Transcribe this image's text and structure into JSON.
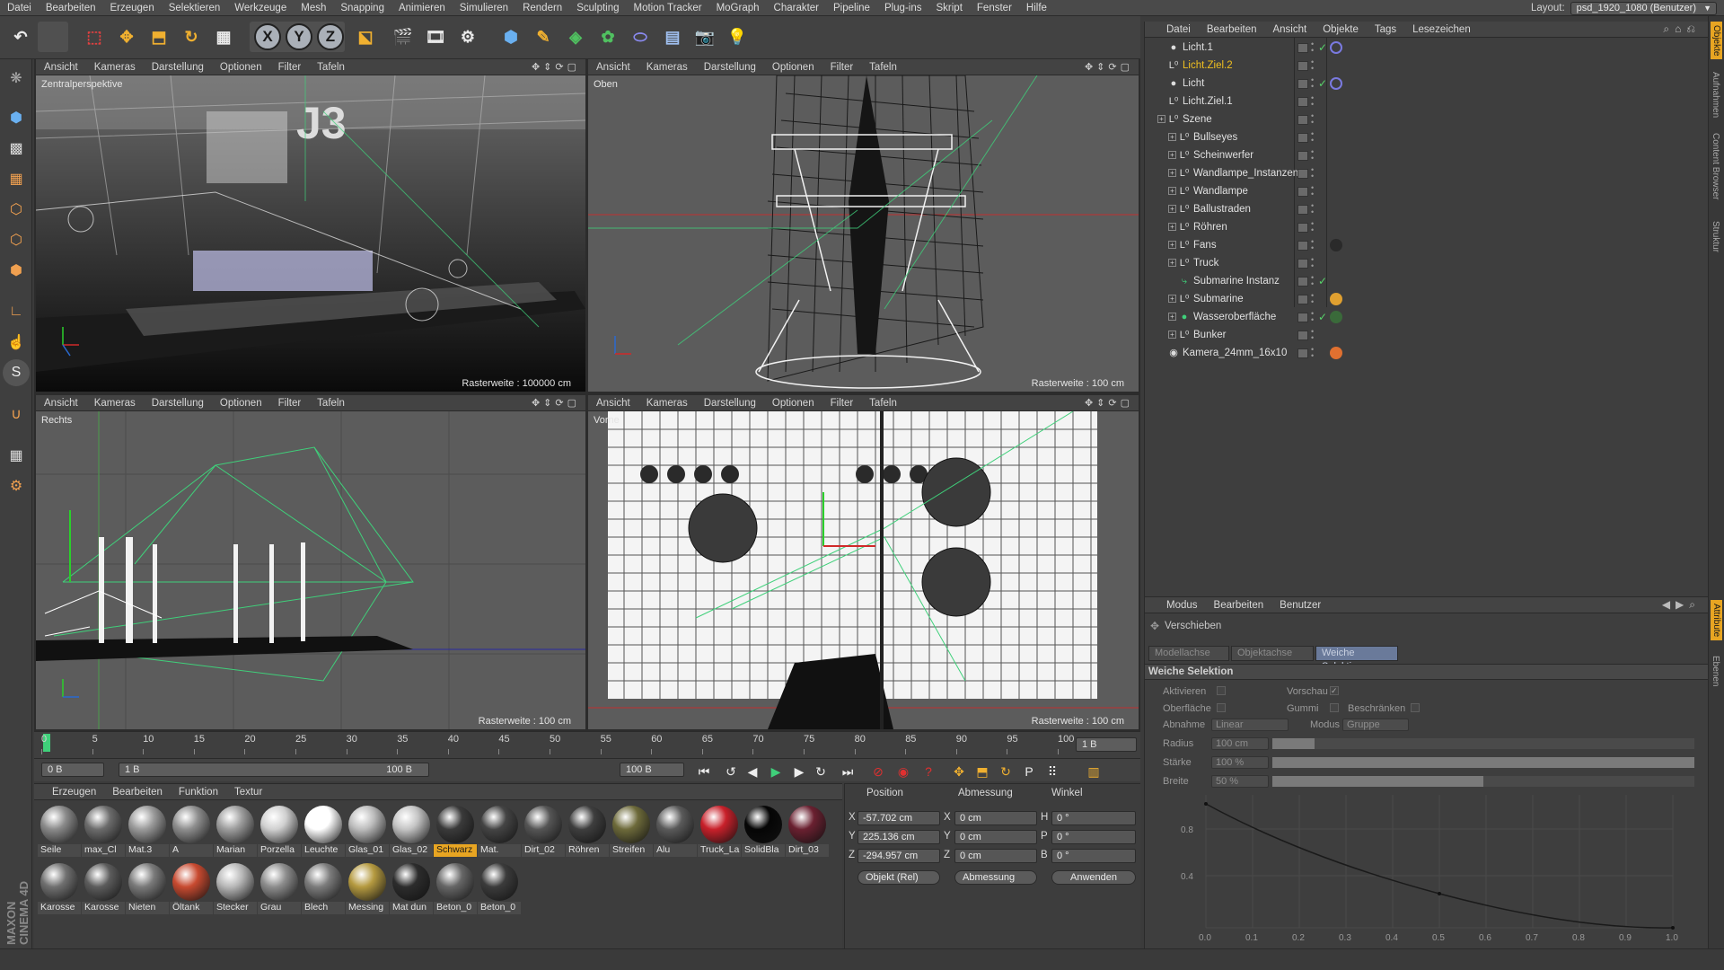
{
  "menubar": {
    "items": [
      "Datei",
      "Bearbeiten",
      "Erzeugen",
      "Selektieren",
      "Werkzeuge",
      "Mesh",
      "Snapping",
      "Animieren",
      "Simulieren",
      "Rendern",
      "Sculpting",
      "Motion Tracker",
      "MoGraph",
      "Charakter",
      "Pipeline",
      "Plug-ins",
      "Skript",
      "Fenster",
      "Hilfe"
    ],
    "layout_label": "Layout:",
    "layout_value": "psd_1920_1080 (Benutzer)"
  },
  "toolbar": {
    "axes": [
      "X",
      "Y",
      "Z"
    ]
  },
  "viewport_menu": [
    "Ansicht",
    "Kameras",
    "Darstellung",
    "Optionen",
    "Filter",
    "Tafeln"
  ],
  "viewports": [
    {
      "name": "Zentralperspektive",
      "grid": "Rasterweite : 100000 cm"
    },
    {
      "name": "Oben",
      "grid": "Rasterweite : 100 cm"
    },
    {
      "name": "Rechts",
      "grid": "Rasterweite : 100 cm"
    },
    {
      "name": "Vorne",
      "grid": "Rasterweite : 100 cm"
    }
  ],
  "timeline": {
    "ticks": [
      "0",
      "5",
      "10",
      "15",
      "20",
      "25",
      "30",
      "35",
      "40",
      "45",
      "50",
      "55",
      "60",
      "65",
      "70",
      "75",
      "80",
      "85",
      "90",
      "95",
      "100"
    ],
    "current_frame": "1 B",
    "start": "0 B",
    "range_start": "1 B",
    "range_end": "100 B",
    "end": "100 B"
  },
  "material_manager": {
    "menu": [
      "Erzeugen",
      "Bearbeiten",
      "Funktion",
      "Textur"
    ],
    "materials": [
      {
        "label": "Seile",
        "color": "#8a8a8a"
      },
      {
        "label": "max_Cl",
        "color": "#6c6c6c"
      },
      {
        "label": "Mat.3",
        "color": "#9a9a9a"
      },
      {
        "label": "A",
        "color": "#8e8e8e"
      },
      {
        "label": "Marian",
        "color": "#9d9d9d"
      },
      {
        "label": "Porzella",
        "color": "#d0d0d0"
      },
      {
        "label": "Leuchte",
        "color": "#ffffff"
      },
      {
        "label": "Glas_01",
        "color": "#bcbcbc"
      },
      {
        "label": "Glas_02",
        "color": "#c4c4c4"
      },
      {
        "label": "Schwarz",
        "color": "#3a3a3a"
      },
      {
        "label": "Mat.",
        "color": "#444444"
      },
      {
        "label": "Dirt_02",
        "color": "#555555"
      },
      {
        "label": "Röhren",
        "color": "#3e3e3e"
      },
      {
        "label": "Streifen",
        "color": "#6d6a3a"
      },
      {
        "label": "Alu",
        "color": "#5a5a5a"
      },
      {
        "label": "Truck_La",
        "color": "#c8202a"
      },
      {
        "label": "SolidBla",
        "color": "#050505"
      },
      {
        "label": "Dirt_03",
        "color": "#6a2030"
      },
      {
        "label": "Karosse",
        "color": "#707070"
      },
      {
        "label": "Karosse",
        "color": "#5c5c5c"
      },
      {
        "label": "Nieten",
        "color": "#7a7a7a"
      },
      {
        "label": "Öltank",
        "color": "#c84a30"
      },
      {
        "label": "Stecker",
        "color": "#b8b8b8"
      },
      {
        "label": "Grau",
        "color": "#8d8d8d"
      },
      {
        "label": "Blech",
        "color": "#7c7c7c"
      },
      {
        "label": "Messing",
        "color": "#b59a40"
      },
      {
        "label": "Mat dun",
        "color": "#2c2c2c"
      },
      {
        "label": "Beton_0",
        "color": "#666666"
      },
      {
        "label": "Beton_0",
        "color": "#3b3b3b"
      }
    ],
    "selected_index": 9
  },
  "coord_manager": {
    "headers": [
      "Position",
      "Abmessung",
      "Winkel"
    ],
    "rows": [
      {
        "axis": "X",
        "pos": "-57.702 cm",
        "size_axis": "X",
        "size": "0 cm",
        "rot_axis": "H",
        "rot": "0 °"
      },
      {
        "axis": "Y",
        "pos": "225.136 cm",
        "size_axis": "Y",
        "size": "0 cm",
        "rot_axis": "P",
        "rot": "0 °"
      },
      {
        "axis": "Z",
        "pos": "-294.957 cm",
        "size_axis": "Z",
        "size": "0 cm",
        "rot_axis": "B",
        "rot": "0 °"
      }
    ],
    "mode": "Objekt (Rel)",
    "size_mode": "Abmessung",
    "apply": "Anwenden"
  },
  "object_manager": {
    "menu": [
      "Datei",
      "Bearbeiten",
      "Ansicht",
      "Objekte",
      "Tags",
      "Lesezeichen"
    ],
    "objects": [
      {
        "name": "Licht.1",
        "indent": 0,
        "expand": false,
        "icon": "light-icon",
        "check": true,
        "tag": "target-tag"
      },
      {
        "name": "Licht.Ziel.2",
        "indent": 0,
        "expand": false,
        "icon": "null-icon",
        "check": false,
        "tag": "",
        "highlight": true
      },
      {
        "name": "Licht",
        "indent": 0,
        "expand": false,
        "icon": "light-icon",
        "check": true,
        "tag": "target-tag"
      },
      {
        "name": "Licht.Ziel.1",
        "indent": 0,
        "expand": false,
        "icon": "null-icon",
        "check": false,
        "tag": ""
      },
      {
        "name": "Szene",
        "indent": 0,
        "expand": true,
        "icon": "null-icon",
        "check": false,
        "tag": ""
      },
      {
        "name": "Bullseyes",
        "indent": 1,
        "expand": true,
        "icon": "null-icon",
        "check": false,
        "tag": ""
      },
      {
        "name": "Scheinwerfer",
        "indent": 1,
        "expand": true,
        "icon": "null-icon",
        "check": false,
        "tag": ""
      },
      {
        "name": "Wandlampe_Instanzen",
        "indent": 1,
        "expand": true,
        "icon": "null-icon",
        "check": false,
        "tag": ""
      },
      {
        "name": "Wandlampe",
        "indent": 1,
        "expand": true,
        "icon": "null-icon",
        "check": false,
        "tag": ""
      },
      {
        "name": "Ballustraden",
        "indent": 1,
        "expand": true,
        "icon": "null-icon",
        "check": false,
        "tag": ""
      },
      {
        "name": "Röhren",
        "indent": 1,
        "expand": true,
        "icon": "null-icon",
        "check": false,
        "tag": ""
      },
      {
        "name": "Fans",
        "indent": 1,
        "expand": true,
        "icon": "null-icon",
        "check": false,
        "tag": "material-tag"
      },
      {
        "name": "Truck",
        "indent": 1,
        "expand": true,
        "icon": "null-icon",
        "check": false,
        "tag": ""
      },
      {
        "name": "Submarine Instanz",
        "indent": 1,
        "expand": false,
        "icon": "instance-icon",
        "check": true,
        "tag": ""
      },
      {
        "name": "Submarine",
        "indent": 1,
        "expand": true,
        "icon": "null-icon",
        "check": false,
        "tag": "lock-tag"
      },
      {
        "name": "Wasseroberfläche",
        "indent": 1,
        "expand": true,
        "icon": "plane-icon",
        "check": true,
        "tag": "water-tag"
      },
      {
        "name": "Bunker",
        "indent": 1,
        "expand": true,
        "icon": "null-icon",
        "check": false,
        "tag": ""
      },
      {
        "name": "Kamera_24mm_16x10",
        "indent": 0,
        "expand": false,
        "icon": "camera-icon",
        "check": false,
        "tag": "stop-tag"
      }
    ]
  },
  "attribute_manager": {
    "menu": [
      "Modus",
      "Bearbeiten",
      "Benutzer"
    ],
    "tool_name": "Verschieben",
    "tabs": [
      "Modellachse",
      "Objektachse",
      "Weiche Selektion"
    ],
    "active_tab": 2,
    "section": "Weiche Selektion",
    "checks": [
      {
        "label": "Aktivieren",
        "checked": false
      },
      {
        "label": "Vorschau",
        "checked": true
      },
      {
        "label": "Oberfläche",
        "checked": false
      },
      {
        "label": "Gummi",
        "checked": false
      },
      {
        "label": "Beschränken",
        "checked": false
      }
    ],
    "falloff_label": "Abnahme",
    "falloff_value": "Linear",
    "mode_label": "Modus",
    "mode_value": "Gruppe",
    "radius_label": "Radius",
    "radius_value": "100 cm",
    "strength_label": "Stärke",
    "strength_value": "100 %",
    "width_label": "Breite",
    "width_value": "50 %",
    "graph_y": [
      "0.8",
      "0.4"
    ],
    "graph_x": [
      "0.0",
      "0.1",
      "0.2",
      "0.3",
      "0.4",
      "0.5",
      "0.6",
      "0.7",
      "0.8",
      "0.9",
      "1.0"
    ]
  },
  "right_tabs": [
    "Objekte",
    "Aufnahmen",
    "Content Browser",
    "Struktur",
    "Attribute",
    "Ebenen"
  ],
  "brand": "MAXON CINEMA 4D",
  "colors": {
    "accent": "#e8a522",
    "check": "#58d36a",
    "axis_x": "#d02a2a",
    "axis_y": "#2ad02a",
    "axis_z": "#2a6ad0",
    "wire": "#3fd07a"
  }
}
